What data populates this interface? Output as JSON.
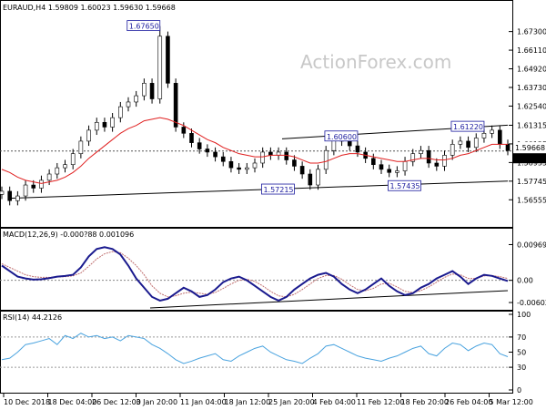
{
  "chart_data": {
    "type": "candlestick",
    "panels": [
      {
        "id": "price",
        "header": "EURAUD,H4  1.59809 1.60023 1.59630 1.59668",
        "watermark": "ActionForex.com",
        "ylim": [
          1.55,
          1.685
        ],
        "yticks": [
          "1.67300",
          "1.66110",
          "1.64920",
          "1.63730",
          "1.62540",
          "1.61315",
          "1.60125",
          "1.58935",
          "1.57745",
          "1.56555"
        ],
        "price_tags": [
          "1.59668",
          "1.59410"
        ],
        "annotations": [
          "1.67650",
          "1.61220",
          "1.60600",
          "1.57435",
          "1.57215"
        ],
        "close": [
          1.571,
          1.565,
          1.568,
          1.575,
          1.573,
          1.578,
          1.582,
          1.586,
          1.588,
          1.595,
          1.603,
          1.61,
          1.615,
          1.612,
          1.618,
          1.625,
          1.628,
          1.632,
          1.64,
          1.63,
          1.67,
          1.64,
          1.612,
          1.608,
          1.602,
          1.598,
          1.596,
          1.593,
          1.59,
          1.586,
          1.585,
          1.586,
          1.589,
          1.596,
          1.594,
          1.596,
          1.591,
          1.587,
          1.582,
          1.575,
          1.585,
          1.597,
          1.604,
          1.603,
          1.6,
          1.596,
          1.592,
          1.588,
          1.585,
          1.583,
          1.584,
          1.59,
          1.595,
          1.597,
          1.589,
          1.587,
          1.594,
          1.601,
          1.603,
          1.599,
          1.605,
          1.608,
          1.61,
          1.601,
          1.597
        ],
        "ma": [
          1.585,
          1.583,
          1.58,
          1.578,
          1.577,
          1.576,
          1.577,
          1.578,
          1.58,
          1.583,
          1.587,
          1.592,
          1.596,
          1.6,
          1.604,
          1.608,
          1.611,
          1.613,
          1.616,
          1.617,
          1.618,
          1.617,
          1.615,
          1.613,
          1.61,
          1.607,
          1.604,
          1.602,
          1.599,
          1.597,
          1.595,
          1.594,
          1.593,
          1.593,
          1.594,
          1.594,
          1.594,
          1.593,
          1.591,
          1.589,
          1.589,
          1.59,
          1.592,
          1.594,
          1.595,
          1.595,
          1.594,
          1.593,
          1.592,
          1.591,
          1.59,
          1.59,
          1.591,
          1.592,
          1.592,
          1.591,
          1.591,
          1.592,
          1.594,
          1.595,
          1.597,
          1.599,
          1.601,
          1.601,
          1.601
        ]
      },
      {
        "id": "macd",
        "header": "MACD(12,26,9) -0.000?88 0.001096",
        "ylim": [
          -0.0075,
          0.0108
        ],
        "yticks": [
          "0.009695",
          "0.00",
          "-0.006025"
        ],
        "macd": [
          0.004,
          0.0025,
          0.001,
          0.0005,
          0.0002,
          0.0003,
          0.0006,
          0.001,
          0.0012,
          0.0015,
          0.0035,
          0.0065,
          0.0085,
          0.009,
          0.0085,
          0.007,
          0.004,
          0.0005,
          -0.002,
          -0.0045,
          -0.0055,
          -0.005,
          -0.0035,
          -0.002,
          -0.003,
          -0.0045,
          -0.004,
          -0.0025,
          -0.0005,
          0.0005,
          0.001,
          0.0,
          -0.0015,
          -0.003,
          -0.0045,
          -0.0055,
          -0.0045,
          -0.0025,
          -0.001,
          0.0005,
          0.0015,
          0.002,
          0.001,
          -0.001,
          -0.0025,
          -0.0035,
          -0.0025,
          -0.001,
          0.0005,
          -0.0015,
          -0.003,
          -0.004,
          -0.0035,
          -0.002,
          -0.001,
          0.0005,
          0.0015,
          0.0025,
          0.001,
          -0.001,
          0.0005,
          0.0015,
          0.0012,
          0.0005,
          -0.0002
        ],
        "signal": [
          0.0045,
          0.0035,
          0.0025,
          0.0015,
          0.001,
          0.0008,
          0.0008,
          0.0009,
          0.001,
          0.0012,
          0.002,
          0.0038,
          0.0058,
          0.0072,
          0.0078,
          0.0075,
          0.006,
          0.004,
          0.0015,
          -0.0015,
          -0.0035,
          -0.0045,
          -0.0042,
          -0.0035,
          -0.0032,
          -0.0035,
          -0.0038,
          -0.0033,
          -0.0022,
          -0.001,
          0.0,
          0.0003,
          -0.0003,
          -0.0015,
          -0.003,
          -0.0042,
          -0.0045,
          -0.0038,
          -0.0025,
          -0.001,
          0.0005,
          0.0013,
          0.0013,
          0.0003,
          -0.0012,
          -0.0025,
          -0.0028,
          -0.0022,
          -0.001,
          -0.0008,
          -0.0018,
          -0.003,
          -0.0033,
          -0.0028,
          -0.0018,
          -0.0005,
          0.0008,
          0.0017,
          0.0015,
          0.0005,
          0.0005,
          0.0012,
          0.0013,
          0.001,
          0.0005
        ]
      },
      {
        "id": "rsi",
        "header": "RSI(14) 44.2126",
        "ylim": [
          0,
          100
        ],
        "yticks": [
          "100",
          "70",
          "50",
          "30",
          "0"
        ],
        "rsi": [
          40,
          42,
          50,
          60,
          62,
          65,
          68,
          60,
          72,
          68,
          75,
          70,
          72,
          68,
          70,
          65,
          72,
          70,
          68,
          60,
          55,
          48,
          40,
          35,
          38,
          42,
          45,
          48,
          40,
          38,
          45,
          50,
          55,
          58,
          50,
          45,
          40,
          38,
          35,
          42,
          48,
          58,
          60,
          55,
          50,
          45,
          42,
          40,
          38,
          42,
          45,
          50,
          55,
          58,
          48,
          45,
          55,
          62,
          60,
          52,
          58,
          62,
          60,
          48,
          44
        ]
      }
    ],
    "x_tick_labels": [
      "10 Dec 2018",
      "18 Dec 04:00",
      "26 Dec 12:00",
      "3 Jan 20:00",
      "11 Jan 04:00",
      "18 Jan 12:00",
      "25 Jan 20:00",
      "4 Feb 04:00",
      "11 Feb 12:00",
      "18 Feb 20:00",
      "26 Feb 04:00",
      "5 Mar 12:00"
    ]
  }
}
